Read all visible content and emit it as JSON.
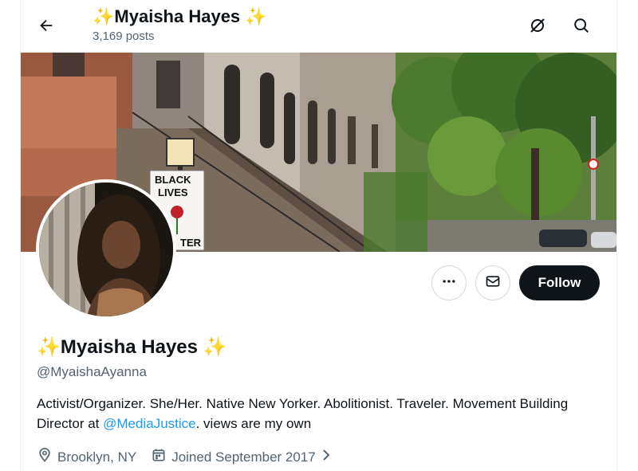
{
  "header": {
    "name_prefix": "✨",
    "name": "Myaisha Hayes",
    "name_suffix": "✨",
    "posts_count": "3,169 posts"
  },
  "icons": {
    "back": "arrow-left-icon",
    "mute": "no-notifications-icon",
    "search": "search-icon",
    "more": "more-horizontal-icon",
    "message": "envelope-icon",
    "location": "location-pin-icon",
    "calendar": "calendar-icon",
    "chevron": "chevron-right-icon"
  },
  "banner": {
    "sign_line1": "BLACK",
    "sign_line2": "LIVES",
    "sign_partial": "TER"
  },
  "actions": {
    "follow_label": "Follow"
  },
  "profile": {
    "display_name_prefix": "✨",
    "display_name": "Myaisha Hayes",
    "display_name_suffix": "✨",
    "handle": "@MyaishaAyanna",
    "bio_text_1": "Activist/Organizer. She/Her. Native New Yorker. Abolitionist. Traveler. Movement Building Director at ",
    "bio_link": "@MediaJustice",
    "bio_text_2": ". views are my own",
    "location": "Brooklyn, NY",
    "joined": "Joined September 2017"
  },
  "colors": {
    "accent": "#1d9bf0",
    "text": "#0f1419",
    "secondary": "#536471",
    "sparkle": "#f4c20d"
  }
}
